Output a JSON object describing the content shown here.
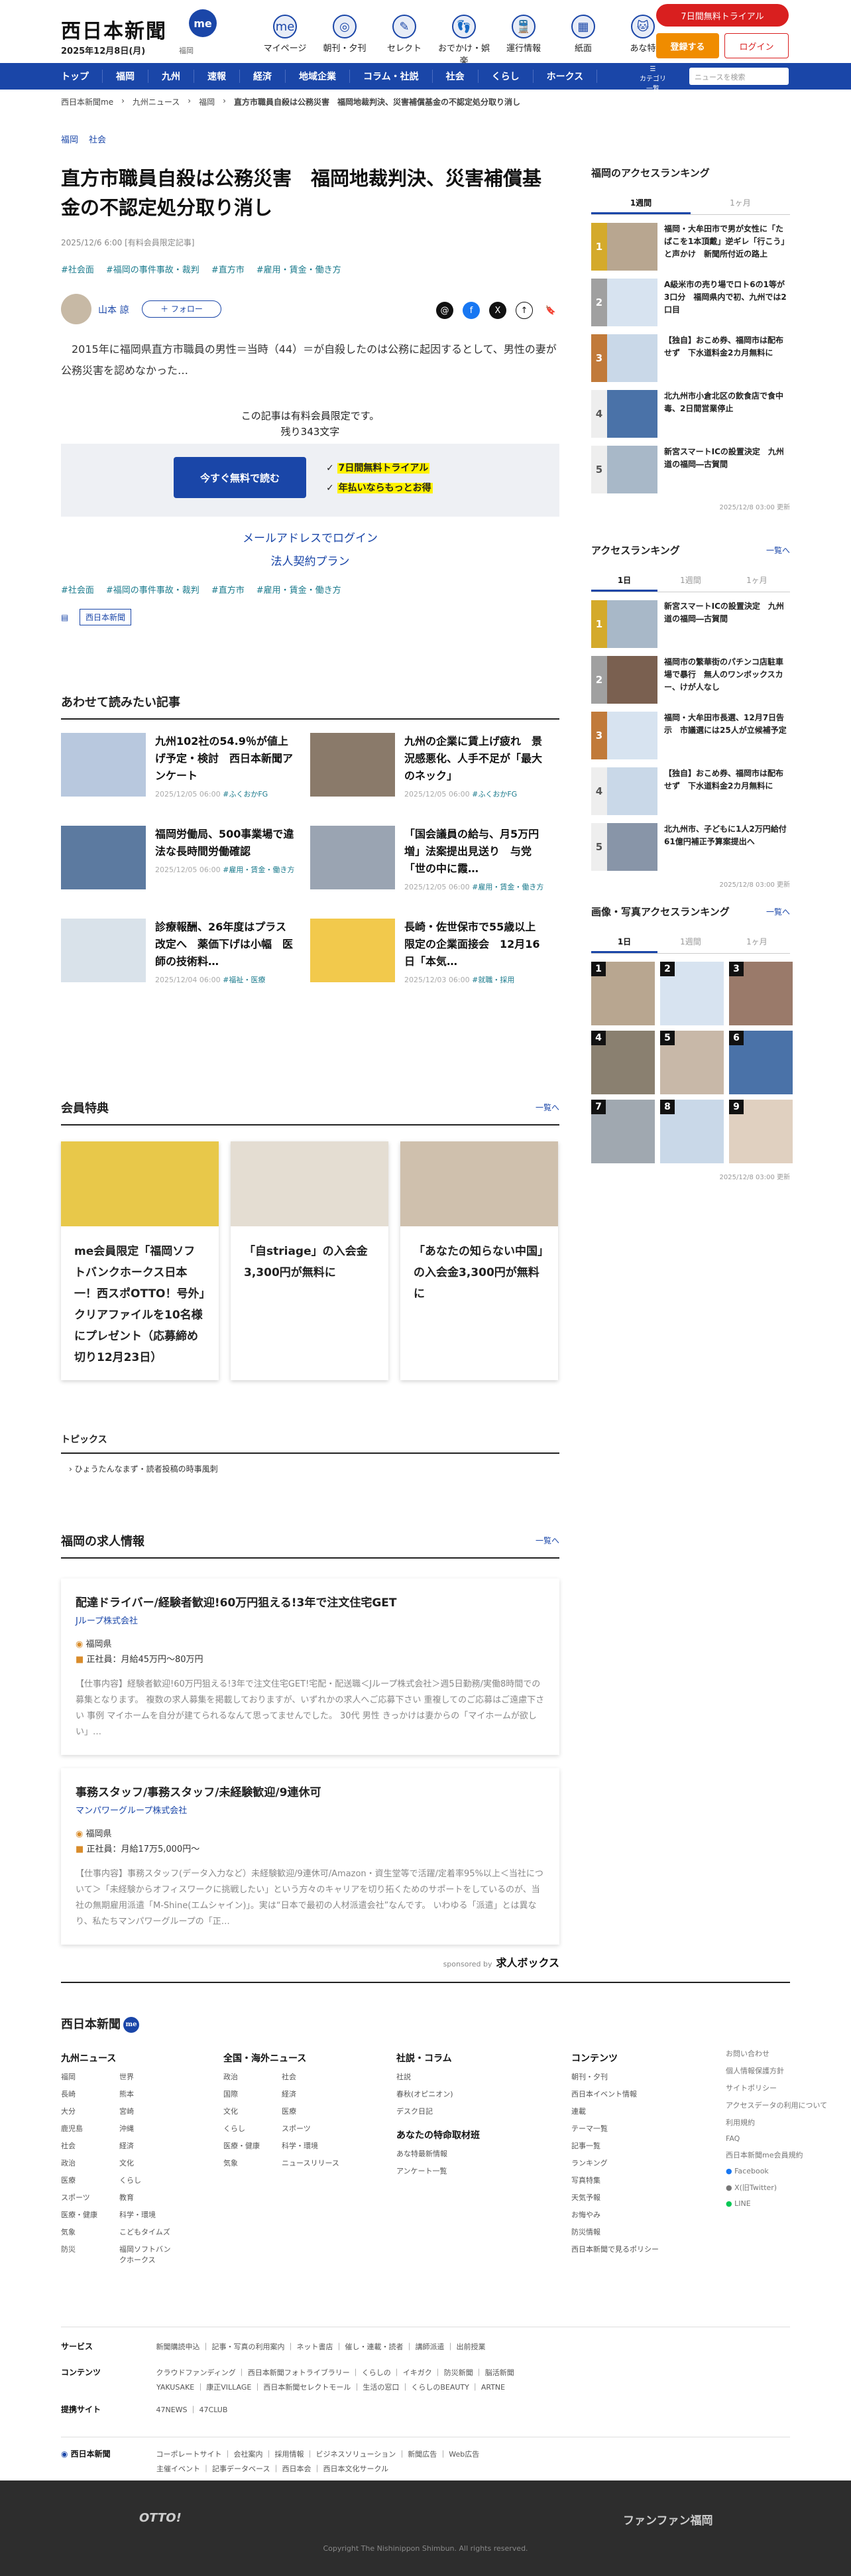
{
  "header": {
    "logo": "西日本新聞",
    "logo_badge": "me",
    "date": "2025年12月8日(月)",
    "weather": "福岡",
    "nav": [
      {
        "icon": "me",
        "label": "マイページ"
      },
      {
        "icon": "◎",
        "label": "朝刊・夕刊"
      },
      {
        "icon": "✎",
        "label": "セレクト"
      },
      {
        "icon": "👣",
        "label": "おでかけ・娯楽"
      },
      {
        "icon": "🚆",
        "label": "運行情報"
      },
      {
        "icon": "▦",
        "label": "紙面"
      },
      {
        "icon": "🐱",
        "label": "あな特"
      }
    ],
    "trial": "7日間無料トライアル",
    "register": "登録する",
    "login": "ログイン"
  },
  "gnav": {
    "items": [
      "トップ",
      "福岡",
      "九州",
      "速報",
      "経済",
      "地域企業",
      "コラム・社説",
      "社会",
      "くらし",
      "ホークス"
    ],
    "menu": "カテゴリ一覧",
    "search_placeholder": "ニュースを検索"
  },
  "breadcrumb": [
    "西日本新聞me",
    "九州ニュース",
    "福岡",
    "直方市職員自殺は公務災害　福岡地裁判決、災害補償基金の不認定処分取り消し"
  ],
  "article": {
    "categories": [
      "福岡",
      "社会"
    ],
    "title": "直方市職員自殺は公務災害　福岡地裁判決、災害補償基金の不認定処分取り消し",
    "meta": "2025/12/6 6:00 [有料会員限定記事]",
    "tags": [
      "#社会面",
      "#福岡の事件事故・裁判",
      "#直方市",
      "#雇用・賃金・働き方"
    ],
    "author": "山本 諒",
    "follow": "＋ フォロー",
    "share": [
      "Threads",
      "f",
      "X",
      "↑",
      "🔖"
    ],
    "lead": "　2015年に福岡県直方市職員の男性＝当時（44）＝が自殺したのは公務に起因するとして、男性の妻が公務災害を認めなかった…",
    "paywall_1": "この記事は有料会員限定です。",
    "paywall_2": "残り343文字",
    "free_btn": "今すぐ無料で読む",
    "perk_1": "7日間無料トライアル",
    "perk_2": "年払いならもっとお得",
    "email_login": "メールアドレスでログイン",
    "corp_plan": "法人契約プラン",
    "tags_bottom": [
      "#社会面",
      "#福岡の事件事故・裁判",
      "#直方市",
      "#雇用・賃金・働き方"
    ],
    "publisher": "西日本新聞"
  },
  "related": {
    "heading": "あわせて読みたい記事",
    "items": [
      {
        "title": "九州102社の54.9％が値上げ予定・検討　西日本新聞アンケート",
        "date": "2025/12/05 06:00",
        "tag": "#ふくおかFG"
      },
      {
        "title": "九州の企業に賃上げ疲れ　景況感悪化、人手不足が「最大のネック」",
        "date": "2025/12/05 06:00",
        "tag": "#ふくおかFG"
      },
      {
        "title": "福岡労働局、500事業場で違法な長時間労働確認",
        "date": "2025/12/05 06:00",
        "tag": "#雇用・賃金・働き方"
      },
      {
        "title": "「国会議員の給与、月5万円増」法案提出見送り　与党「世の中に霞…",
        "date": "2025/12/05 06:00",
        "tag": "#雇用・賃金・働き方"
      },
      {
        "title": "診療報酬、26年度はプラス改定へ　薬価下げは小幅　医師の技術料…",
        "date": "2025/12/04 06:00",
        "tag": "#福祉・医療"
      },
      {
        "title": "長崎・佐世保市で55歳以上限定の企業面接会　12月16日「本気…",
        "date": "2025/12/03 06:00",
        "tag": "#就職・採用"
      }
    ]
  },
  "benefits": {
    "heading": "会員特典",
    "more": "一覧へ",
    "items": [
      {
        "title": "me会員限定「福岡ソフトバンクホークス日本一！西スポOTTO！号外」クリアファイルを10名様にプレゼント（応募締め切り12月23日）"
      },
      {
        "title": "「自striage」の入会金3,300円が無料に"
      },
      {
        "title": "「あなたの知らない中国」の入会金3,300円が無料に"
      }
    ]
  },
  "topics": {
    "heading": "トピックス",
    "item": "ひょうたんなまず・読者投稿の時事風刺"
  },
  "jobs": {
    "heading": "福岡の求人情報",
    "more": "一覧へ",
    "items": [
      {
        "title": "配達ドライバー/経験者歓迎!60万円狙える!3年で注文住宅GET",
        "company": "Jループ株式会社",
        "location": "福岡県",
        "salary": "正社員：月給45万円〜80万円",
        "desc": "【仕事内容】経験者歓迎!60万円狙える!3年で注文住宅GET!宅配・配送職＜Jループ株式会社＞週5日勤務/実働8時間での募集となります。 複数の求人募集を掲載しておりますが、いずれかの求人へご応募下さい 重複してのご応募はご遠慮下さい 事例 マイホームを自分が建てられるなんて思ってませんでした。 30代 男性 きっかけは妻からの「マイホームが欲しい」…"
      },
      {
        "title": "事務スタッフ/事務スタッフ/未経験歓迎/9連休可",
        "company": "マンパワーグループ株式会社",
        "location": "福岡県",
        "salary": "正社員：月給17万5,000円〜",
        "desc": "【仕事内容】事務スタッフ(データ入力など）未経験歓迎/9連休可/Amazon・資生堂等で活躍/定着率95%以上＜当社について＞「未経験からオフィスワークに挑戦したい」という方々のキャリアを切り拓くためのサポートをしているのが、当社の無期雇用派遣「M-Shine(エムシャイン)」。実は“日本で最初の人材派遣会社”なんです。 いわゆる「派遣」とは異なり、私たちマンパワーグループの「正…"
      }
    ],
    "sponsor": "sponsored by",
    "sponsor_name": "求人ボックス"
  },
  "sidebar": {
    "access_fukuoka": {
      "heading": "福岡のアクセスランキング",
      "tabs": [
        "1週間",
        "1ヶ月"
      ],
      "items": [
        "福岡・大牟田市で男が女性に「たばこを1本頂戴」逆ギレ「行こう」と声かけ　新聞所付近の路上",
        "A級米市の売り場でロト6の1等が3口分　福岡県内で初、九州では2口目",
        "【独自】おこめ券、福岡市は配布せず　下水道料金2カ月無料に",
        "北九州市小倉北区の飲食店で食中毒、2日間営業停止",
        "新宮スマートICの設置決定　九州道の福岡―古賀間"
      ],
      "updated": "2025/12/8 03:00 更新"
    },
    "access": {
      "heading": "アクセスランキング",
      "more": "一覧へ",
      "tabs": [
        "1日",
        "1週間",
        "1ヶ月"
      ],
      "items": [
        "新宮スマートICの設置決定　九州道の福岡―古賀間",
        "福岡市の繁華街のパチンコ店駐車場で暴行　無人のワンボックスカー、けが人なし",
        "福岡・大牟田市長選、12月7日告示　市議選には25人が立候補予定",
        "【独自】おこめ券、福岡市は配布せず　下水道料金2カ月無料に",
        "北九州市、子どもに1人2万円給付　61億円補正予算案提出へ"
      ],
      "updated": "2025/12/8 03:00 更新"
    },
    "photo": {
      "heading": "画像・写真アクセスランキング",
      "more": "一覧へ",
      "tabs": [
        "1日",
        "1週間",
        "1ヶ月"
      ],
      "numbers": [
        "1",
        "2",
        "3",
        "4",
        "5",
        "6",
        "7",
        "8",
        "9"
      ],
      "updated": "2025/12/8 03:00 更新"
    }
  },
  "footer": {
    "logo": "西日本新聞",
    "logo_badge": "me",
    "kyushu": {
      "heading": "九州ニュース",
      "items": [
        "福岡",
        "世界",
        "長崎",
        "熊本",
        "大分",
        "宮崎",
        "鹿児島",
        "沖縄",
        "社会",
        "経済",
        "政治",
        "文化",
        "医療",
        "くらし",
        "スポーツ",
        "教育",
        "医療・健康",
        "科学・環境",
        "気象",
        "こどもタイムズ",
        "防災",
        "福岡ソフトバンクホークス"
      ]
    },
    "national": {
      "heading": "全国・海外ニュース",
      "items": [
        "政治",
        "社会",
        "国際",
        "経済",
        "文化",
        "医療",
        "くらし",
        "スポーツ",
        "医療・健康",
        "科学・環境",
        "気象",
        "ニュースリリース"
      ]
    },
    "opinion": {
      "heading": "社説・コラム",
      "items": [
        "社説",
        "春秋(オピニオン)",
        "デスク日記"
      ],
      "sub_heading": "あなたの特命取材班",
      "sub_items": [
        "あな特最新情報",
        "アンケート一覧"
      ]
    },
    "contents": {
      "heading": "コンテンツ",
      "items": [
        "朝刊・夕刊",
        "西日本イベント情報",
        "連載",
        "テーマ一覧",
        "記事一覧",
        "ランキング",
        "写真特集",
        "天気予報",
        "お悔やみ",
        "防災情報",
        "西日本新聞で見るポリシー"
      ]
    },
    "misc": {
      "items": [
        "お問い合わせ",
        "個人情報保護方針",
        "サイトポリシー",
        "アクセスデータの利用について",
        "利用規約",
        "FAQ",
        "西日本新聞me会員規約",
        "Facebook",
        "X(旧Twitter)",
        "LINE"
      ]
    },
    "service": {
      "label": "サービス",
      "items": [
        "新聞購読申込",
        "記事・写真の利用案内",
        "ネット書店",
        "催し・連載・読者",
        "講師派遣",
        "出前授業"
      ]
    },
    "contents_row": {
      "label": "コンテンツ",
      "items": [
        "クラウドファンディング",
        "西日本新聞フォトライブラリー",
        "くらしの",
        "イキガク",
        "防災新聞",
        "脳活新聞",
        "YAKUSAKE",
        "康正VILLAGE",
        "西日本新聞セレクトモール",
        "生活の窓口",
        "くらしのBEAUTY",
        "ARTNE"
      ]
    },
    "provider": {
      "label": "提携サイト",
      "items": [
        "47NEWS",
        "47CLUB"
      ]
    },
    "corp": {
      "label": "西日本新聞",
      "items": [
        "コーポレートサイト",
        "会社案内",
        "採用情報",
        "ビジネスソリューション",
        "新聞広告",
        "Web広告",
        "主催イベント",
        "記事データベース",
        "西日本会",
        "西日本文化サークル"
      ]
    },
    "otto": "OTTO!",
    "fan": "ファンファン福岡",
    "copyright": "Copyright The Nishinippon Shimbun. All rights reserved."
  }
}
